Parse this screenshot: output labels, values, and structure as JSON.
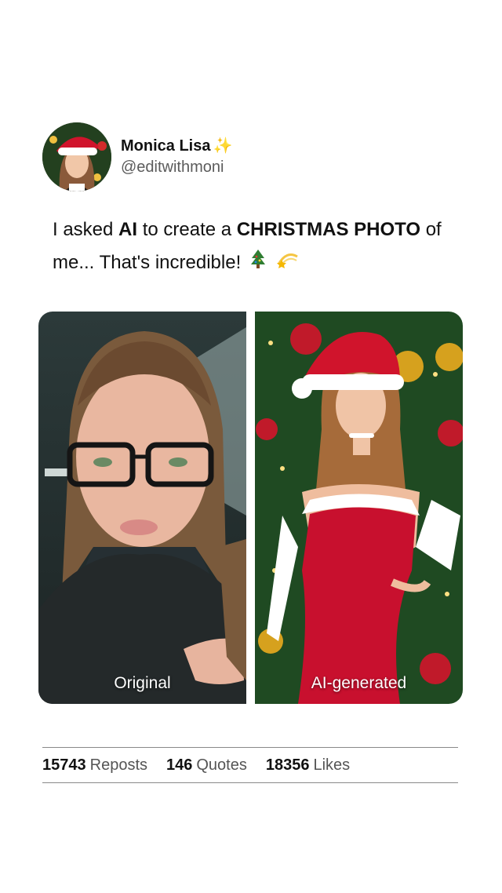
{
  "post": {
    "author": {
      "display_name": "Monica Lisa",
      "badge_icon": "sparkles-icon",
      "handle": "@editwithmoni"
    },
    "text": {
      "part1": "I asked ",
      "bold1": "AI",
      "part2": " to create a ",
      "bold2": "CHRISTMAS PHOTO",
      "part3": " of me... That's incredible!",
      "emojis": [
        "christmas-tree-icon",
        "dizzy-star-icon"
      ]
    },
    "media": [
      {
        "caption": "Original"
      },
      {
        "caption": "AI-generated"
      }
    ],
    "stats": {
      "reposts_count": "15743",
      "reposts_label": "Reposts",
      "quotes_count": "146",
      "quotes_label": "Quotes",
      "likes_count": "18356",
      "likes_label": "Likes"
    }
  },
  "colors": {
    "text": "#111111",
    "secondary_text": "#5b5b5b",
    "divider": "#8a8a8a",
    "santa_red": "#c8102e"
  }
}
